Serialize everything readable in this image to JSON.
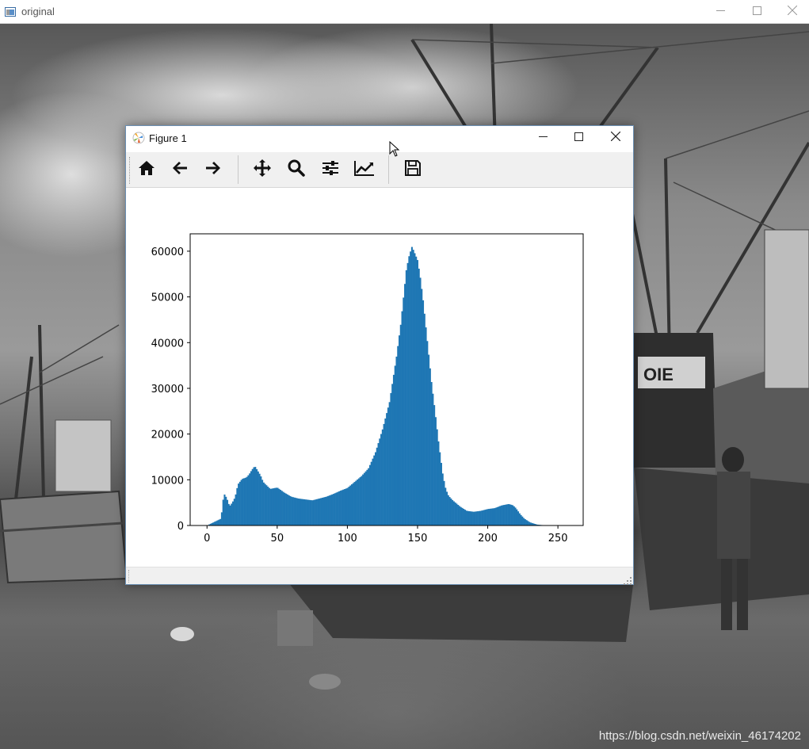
{
  "outer_window": {
    "title": "original",
    "icons": [
      "app-icon",
      "minimize-icon",
      "maximize-icon",
      "close-icon"
    ]
  },
  "figure_window": {
    "title": "Figure 1",
    "toolbar": [
      "home-icon",
      "back-arrow-icon",
      "forward-arrow-icon",
      "pan-icon",
      "zoom-icon",
      "configure-subplots-icon",
      "edit-axis-icon",
      "save-icon"
    ]
  },
  "watermark": "https://blog.csdn.net/weixin_46174202",
  "colors": {
    "bar": "#1f77b4"
  },
  "chart_data": {
    "type": "bar",
    "title": "",
    "xlabel": "",
    "ylabel": "",
    "xlim": [
      -12,
      268
    ],
    "ylim": [
      0,
      63800
    ],
    "x_ticks": [
      0,
      50,
      100,
      150,
      200,
      250
    ],
    "y_ticks": [
      0,
      10000,
      20000,
      30000,
      40000,
      50000,
      60000
    ],
    "x_tick_labels": [
      "0",
      "50",
      "100",
      "150",
      "200",
      "250"
    ],
    "y_tick_labels": [
      "0",
      "10000",
      "20000",
      "30000",
      "40000",
      "50000",
      "60000"
    ],
    "bins": 256,
    "x": [
      0,
      10,
      11,
      12,
      14,
      16,
      18,
      20,
      22,
      25,
      28,
      30,
      32,
      34,
      36,
      38,
      40,
      45,
      50,
      55,
      60,
      65,
      70,
      75,
      80,
      85,
      90,
      95,
      100,
      105,
      110,
      115,
      120,
      125,
      130,
      135,
      138,
      140,
      142,
      144,
      146,
      148,
      150,
      152,
      154,
      156,
      158,
      160,
      162,
      165,
      168,
      170,
      172,
      175,
      180,
      185,
      190,
      195,
      200,
      205,
      210,
      215,
      218,
      220,
      223,
      226,
      230,
      235,
      240,
      245,
      250,
      255
    ],
    "y": [
      0,
      1500,
      4500,
      7000,
      6000,
      4200,
      5000,
      6200,
      9000,
      10200,
      10500,
      11200,
      12200,
      13000,
      12000,
      11000,
      9500,
      8000,
      8300,
      7200,
      6300,
      5900,
      5700,
      5500,
      5900,
      6300,
      6900,
      7600,
      8200,
      9500,
      10800,
      12500,
      16000,
      21000,
      27000,
      37000,
      44000,
      50000,
      56000,
      59000,
      61000,
      59500,
      58000,
      54000,
      49000,
      43000,
      37000,
      31000,
      26000,
      18000,
      11000,
      8000,
      6500,
      5500,
      4200,
      3200,
      3000,
      3200,
      3600,
      3800,
      4400,
      4700,
      4400,
      3800,
      2500,
      1500,
      700,
      200,
      50,
      10,
      0,
      0
    ]
  }
}
